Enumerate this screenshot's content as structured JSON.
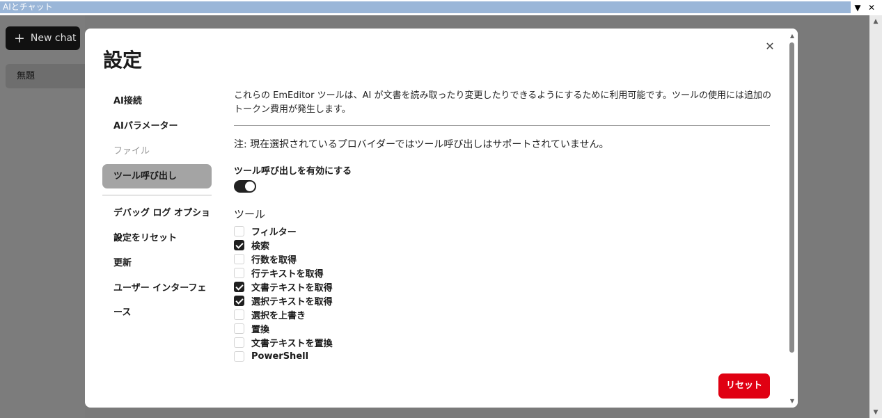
{
  "window": {
    "title": "AIとチャット",
    "dropdown_glyph": "▼",
    "close_glyph": "✕"
  },
  "sidebar": {
    "new_chat_label": "New chat",
    "chats": [
      {
        "label": "無題"
      }
    ]
  },
  "dialog": {
    "title": "設定",
    "close_glyph": "✕",
    "nav": [
      {
        "label": "AI接続",
        "state": "normal"
      },
      {
        "label": "AIパラメーター",
        "state": "normal"
      },
      {
        "label": "ファイル",
        "state": "disabled"
      },
      {
        "label": "ツール呼び出し",
        "state": "active"
      },
      {
        "label": "デバッグ ログ オプション",
        "state": "normal"
      },
      {
        "label": "設定をリセット",
        "state": "normal"
      },
      {
        "label": "更新",
        "state": "normal"
      },
      {
        "label": "ユーザー インターフェース",
        "state": "normal"
      }
    ],
    "content": {
      "description": "これらの EmEditor ツールは、AI が文書を読み取ったり変更したりできるようにするために利用可能です。ツールの使用には追加のトークン費用が発生します。",
      "note": "注: 現在選択されているプロバイダーではツール呼び出しはサポートされていません。",
      "enable_label": "ツール呼び出しを有効にする",
      "enable_on": true,
      "tools_heading": "ツール",
      "tools": [
        {
          "label": "フィルター",
          "checked": false
        },
        {
          "label": "検索",
          "checked": true
        },
        {
          "label": "行数を取得",
          "checked": false
        },
        {
          "label": "行テキストを取得",
          "checked": false
        },
        {
          "label": "文書テキストを取得",
          "checked": true
        },
        {
          "label": "選択テキストを取得",
          "checked": true
        },
        {
          "label": "選択を上書き",
          "checked": false
        },
        {
          "label": "置換",
          "checked": false
        },
        {
          "label": "文書テキストを置換",
          "checked": false
        },
        {
          "label": "PowerShell",
          "checked": false
        }
      ],
      "reset_label": "リセット"
    }
  },
  "colors": {
    "accent_reset": "#e00012",
    "titlebar": "#9ab6d8",
    "active_nav": "#a4a4a4"
  }
}
